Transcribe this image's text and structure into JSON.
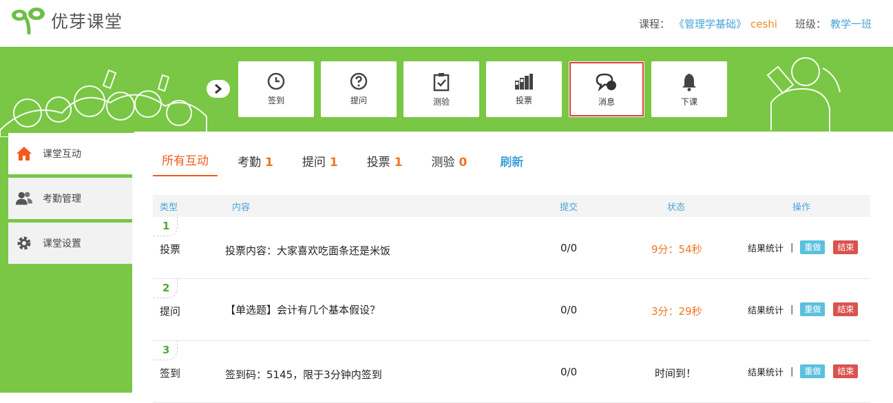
{
  "brand": {
    "name": "优芽课堂"
  },
  "course": {
    "course_label": "课程：",
    "course_name": "《管理学基础》",
    "course_suffix": "ceshi",
    "class_label": "班级：",
    "class_name": "教学一班"
  },
  "toolbar": [
    {
      "label": "签到",
      "icon": "clock-icon"
    },
    {
      "label": "提问",
      "icon": "question-icon"
    },
    {
      "label": "测验",
      "icon": "clipboard-check-icon"
    },
    {
      "label": "投票",
      "icon": "bar-chart-icon"
    },
    {
      "label": "消息",
      "icon": "chat-bubbles-icon",
      "active": true
    },
    {
      "label": "下课",
      "icon": "bell-icon"
    }
  ],
  "sidebar": [
    {
      "label": "课堂互动",
      "icon": "home-icon",
      "active": true
    },
    {
      "label": "考勤管理",
      "icon": "users-icon"
    },
    {
      "label": "课堂设置",
      "icon": "gear-icon"
    }
  ],
  "tabs": [
    {
      "label": "所有互动",
      "count": ""
    },
    {
      "label": "考勤",
      "count": "1"
    },
    {
      "label": "提问",
      "count": "1"
    },
    {
      "label": "投票",
      "count": "1"
    },
    {
      "label": "测验",
      "count": "0"
    },
    {
      "label": "刷新",
      "count": ""
    }
  ],
  "table": {
    "headers": {
      "type": "类型",
      "content": "内容",
      "submit": "提交",
      "status": "状态",
      "ops": "操作"
    },
    "rows": [
      {
        "index": "1",
        "type": "投票",
        "content": "投票内容：大家喜欢吃面条还是米饭",
        "submit": "0/0",
        "status": "9分：54秒",
        "stats": "结果统计",
        "redo": "重做",
        "end": "结束"
      },
      {
        "index": "2",
        "type": "提问",
        "content": "【单选题】会计有几个基本假设？",
        "submit": "0/0",
        "status": "3分：29秒",
        "stats": "结果统计",
        "redo": "重做",
        "end": "结束"
      },
      {
        "index": "3",
        "type": "签到",
        "content": "签到码：5145，限于3分钟内签到",
        "submit": "0/0",
        "status": "时间到！",
        "stats": "结果统计",
        "redo": "重做",
        "end": "结束"
      }
    ]
  },
  "colors": {
    "green": "#79c744",
    "accent_orange": "#f05a1a",
    "link_blue": "#47a4d8",
    "active_red": "#e33a3a"
  }
}
